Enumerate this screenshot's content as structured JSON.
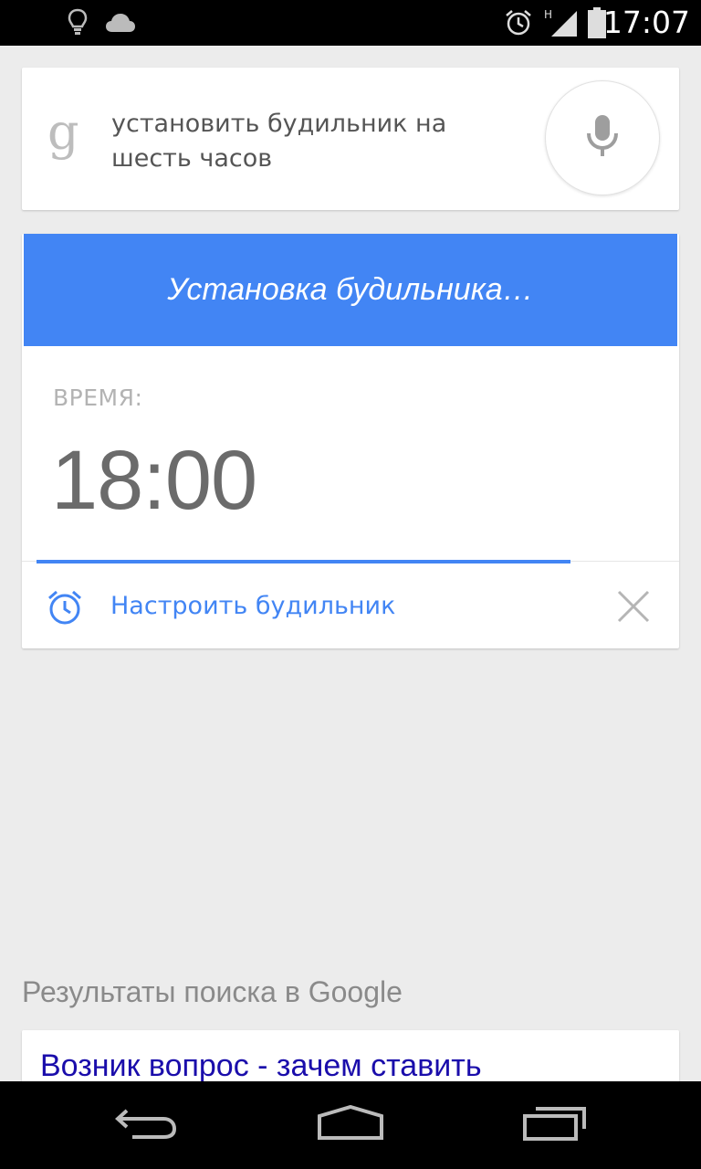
{
  "status_bar": {
    "time": "17:07",
    "network_type": "H",
    "icons": [
      "lightbulb-icon",
      "cloud-icon",
      "alarm-clock-icon",
      "signal-icon",
      "battery-icon"
    ]
  },
  "search": {
    "logo": "g",
    "query": "установить будильник на шесть часов"
  },
  "alarm": {
    "header": "Установка будильника…",
    "time_label": "ВРЕМЯ:",
    "time_value": "18:00",
    "action_label": "Настроить будильник",
    "progress": 0.85
  },
  "results": {
    "title": "Результаты поиска в Google",
    "first_result": "Возник вопрос - зачем ставить"
  },
  "colors": {
    "accent": "#4285f4",
    "link": "#1a0dab",
    "background": "#ececec"
  }
}
